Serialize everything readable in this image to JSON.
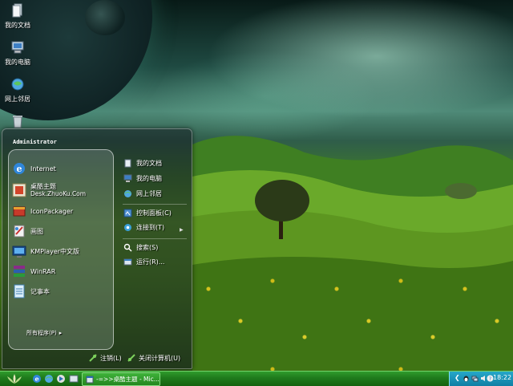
{
  "desktop": {
    "icons": [
      {
        "label": "我的文档",
        "icon": "documents-icon"
      },
      {
        "label": "我的电脑",
        "icon": "computer-icon"
      },
      {
        "label": "网上邻居",
        "icon": "network-icon"
      },
      {
        "label": "",
        "icon": "recycle-bin-icon"
      }
    ]
  },
  "start_menu": {
    "user": "Administrator",
    "programs": [
      {
        "label": "Internet",
        "sub": "",
        "icon": "internet-explorer-icon"
      },
      {
        "label": "桌酷主题",
        "sub": "Desk.ZhuoKu.Com",
        "icon": "zhuoku-theme-icon"
      },
      {
        "label": "IconPackager",
        "sub": "",
        "icon": "iconpackager-icon"
      },
      {
        "label": "画图",
        "sub": "",
        "icon": "paint-icon"
      },
      {
        "label": "KMPlayer中文版",
        "sub": "",
        "icon": "kmplayer-icon"
      },
      {
        "label": "WinRAR",
        "sub": "",
        "icon": "winrar-icon"
      },
      {
        "label": "记事本",
        "sub": "",
        "icon": "notepad-icon"
      }
    ],
    "all_programs": "所有程序(P)",
    "places": [
      {
        "label": "我的文档",
        "icon": "documents-icon"
      },
      {
        "label": "我的电脑",
        "icon": "computer-icon"
      },
      {
        "label": "网上邻居",
        "icon": "network-icon"
      },
      {
        "label": "控制面板(C)",
        "icon": "control-panel-icon"
      },
      {
        "label": "连接到(T)",
        "icon": "connect-icon"
      },
      {
        "label": "搜索(S)",
        "icon": "search-icon"
      },
      {
        "label": "运行(R)...",
        "icon": "run-icon"
      }
    ],
    "logoff": "注销(L)",
    "shutdown": "关闭计算机(U)"
  },
  "taskbar": {
    "task_label": "-=>>桌酷主题 - Mic...",
    "clock": "18:22"
  },
  "colors": {
    "taskbar": "#1f7a1c",
    "tray": "#1a8fb6"
  }
}
